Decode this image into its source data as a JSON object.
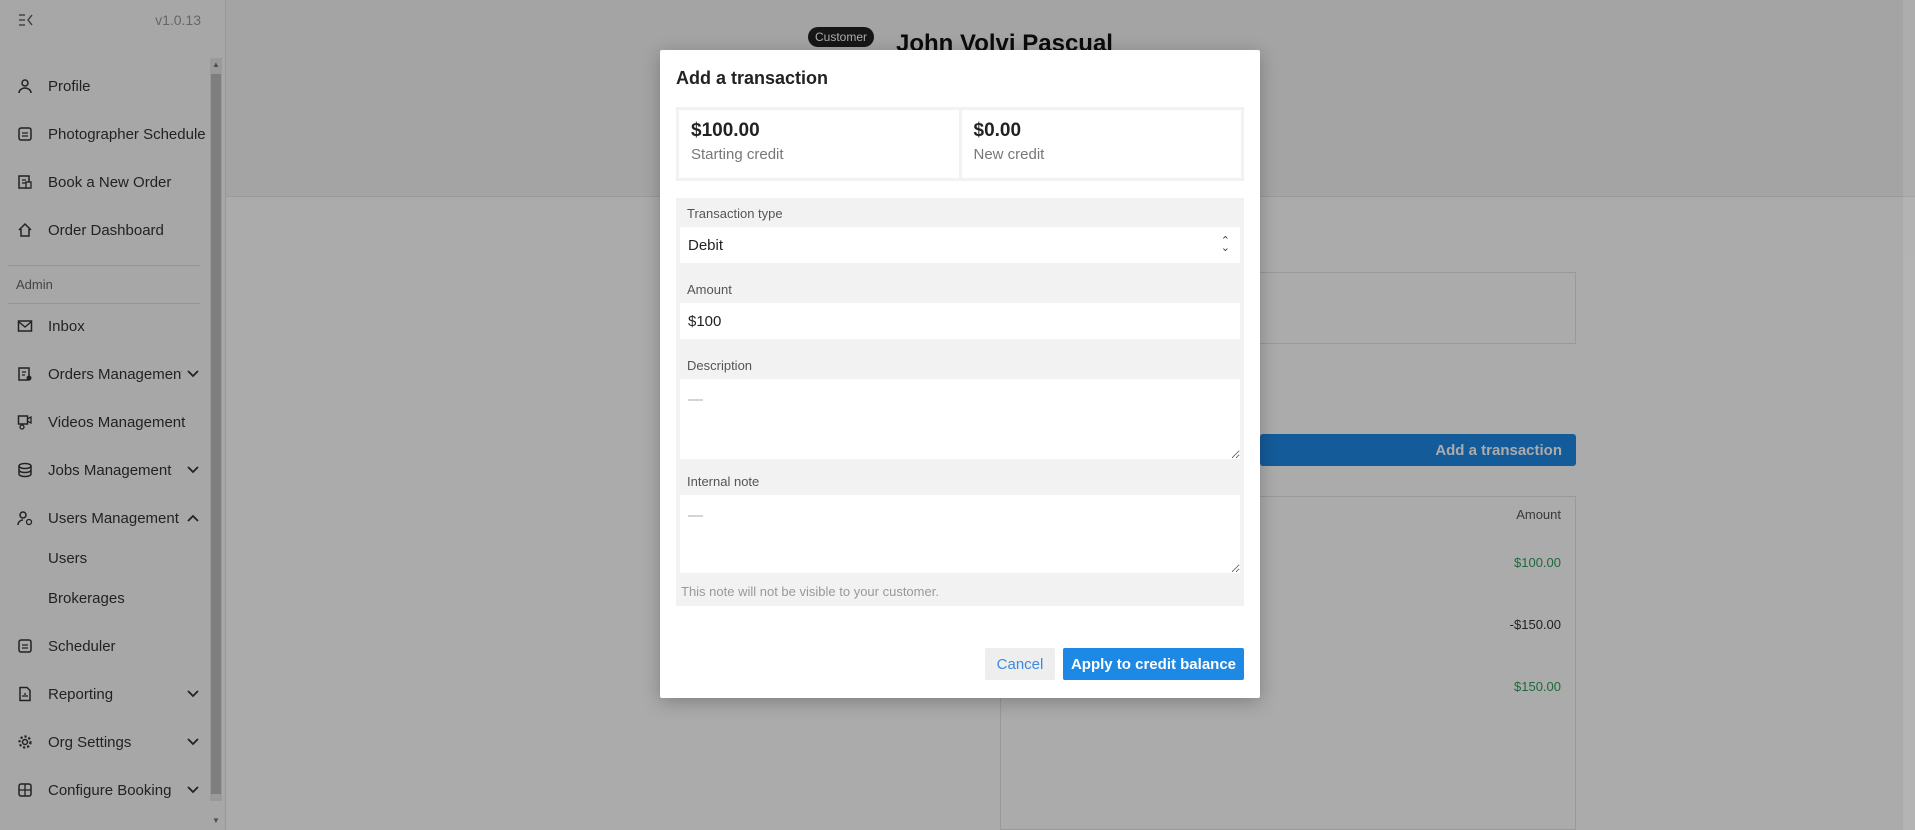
{
  "app": {
    "version": "v1.0.13"
  },
  "sidebar": {
    "items": [
      {
        "label": "Profile",
        "icon": "user-icon"
      },
      {
        "label": "Photographer Schedule",
        "icon": "calendar-icon"
      },
      {
        "label": "Book a New Order",
        "icon": "order-icon"
      },
      {
        "label": "Order Dashboard",
        "icon": "home-icon"
      }
    ],
    "admin_label": "Admin",
    "admin_items": [
      {
        "label": "Inbox",
        "icon": "mail-icon"
      },
      {
        "label": "Orders Management",
        "icon": "orders-icon",
        "chevron": "down"
      },
      {
        "label": "Videos Management",
        "icon": "video-icon"
      },
      {
        "label": "Jobs Management",
        "icon": "jobs-icon",
        "chevron": "down"
      },
      {
        "label": "Users Management",
        "icon": "users-icon",
        "chevron": "up"
      },
      {
        "label": "Users",
        "sub": true
      },
      {
        "label": "Brokerages",
        "sub": true
      },
      {
        "label": "Scheduler",
        "icon": "scheduler-icon"
      },
      {
        "label": "Reporting",
        "icon": "report-icon",
        "chevron": "down"
      },
      {
        "label": "Org Settings",
        "icon": "gear-icon",
        "chevron": "down"
      },
      {
        "label": "Configure Booking",
        "icon": "booking-icon",
        "chevron": "down"
      }
    ]
  },
  "page": {
    "badge": "Customer",
    "customer_name": "John Volvi Pascual",
    "add_button": "Add a transaction",
    "table_header_amount": "Amount",
    "amounts": [
      "$100.00",
      "-$150.00",
      "$150.00"
    ],
    "amount_colors": [
      "#2e9e5b",
      "#333333",
      "#2e9e5b"
    ]
  },
  "modal": {
    "title": "Add a transaction",
    "starting_credit_value": "$100.00",
    "starting_credit_label": "Starting credit",
    "new_credit_value": "$0.00",
    "new_credit_label": "New credit",
    "transaction_type_label": "Transaction type",
    "transaction_type_value": "Debit",
    "amount_label": "Amount",
    "amount_value": "$100",
    "description_label": "Description",
    "description_placeholder": "—",
    "internal_note_label": "Internal note",
    "internal_note_placeholder": "—",
    "internal_note_hint": "This note will not be visible to your customer.",
    "cancel_label": "Cancel",
    "apply_label": "Apply to credit balance"
  },
  "colors": {
    "accent": "#1e88e5",
    "positive": "#2e9e5b"
  }
}
